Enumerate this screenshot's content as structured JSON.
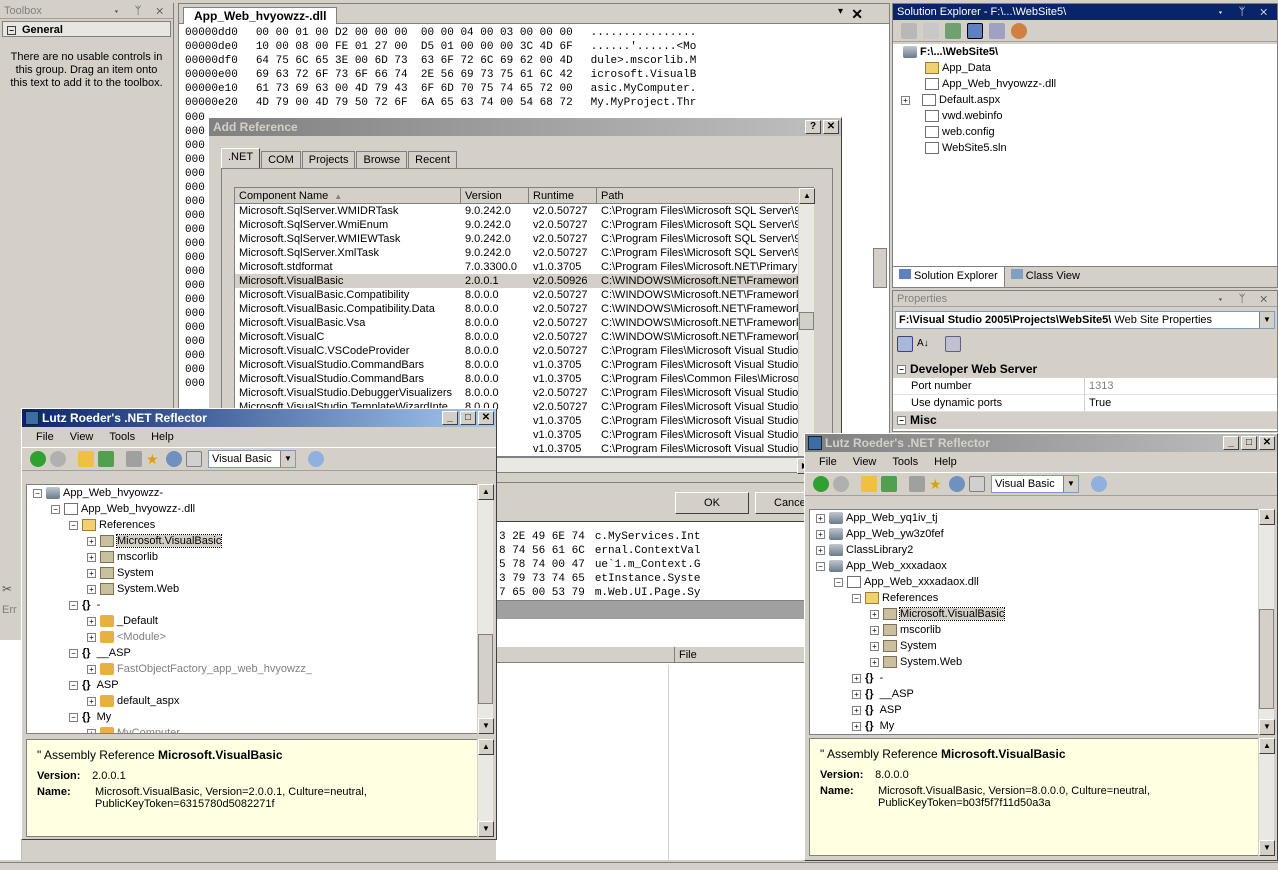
{
  "toolbox": {
    "title": "Toolbox",
    "ctl": "▾ ᛘ ✕",
    "section": "General",
    "empty_text": "There are no usable controls in this group. Drag an item onto this text to add it to the toolbox."
  },
  "hex_editor": {
    "tab": "App_Web_hvyowzz-.dll",
    "lines_top": [
      {
        "addr": "00000dd0",
        "bytes": "00 00 01 00 D2 00 00 00  00 00 04 00 03 00 00 00",
        "ascii": "................"
      },
      {
        "addr": "00000de0",
        "bytes": "10 00 08 00 FE 01 27 00  D5 01 00 00 00 3C 4D 6F",
        "ascii": "......'......<Mo"
      },
      {
        "addr": "00000df0",
        "bytes": "64 75 6C 65 3E 00 6D 73  63 6F 72 6C 69 62 00 4D",
        "ascii": "dule>.mscorlib.M"
      },
      {
        "addr": "00000e00",
        "bytes": "69 63 72 6F 73 6F 66 74  2E 56 69 73 75 61 6C 42",
        "ascii": "icrosoft.VisualB"
      },
      {
        "addr": "00000e10",
        "bytes": "61 73 69 63 00 4D 79 43  6F 6D 70 75 74 65 72 00",
        "ascii": "asic.MyComputer."
      },
      {
        "addr": "00000e20",
        "bytes": "4D 79 00 4D 79 50 72 6F  6A 65 63 74 00 54 68 72",
        "ascii": "My.MyProject.Thr"
      }
    ],
    "lines_bottom": [
      {
        "bytes": "3 2E 49 6E 74",
        "ascii": "c.MyServices.Int"
      },
      {
        "bytes": "8 74 56 61 6C",
        "ascii": "ernal.ContextVal"
      },
      {
        "bytes": "5 78 74 00 47",
        "ascii": "ue`1.m_Context.G"
      },
      {
        "bytes": "3 79 73 74 65",
        "ascii": "etInstance.Syste"
      },
      {
        "bytes": "7 65 00 53 79",
        "ascii": "m.Web.UI.Page.Sy"
      }
    ],
    "left_stubs": [
      "000",
      "000",
      "000",
      "000",
      "000",
      "000",
      "000",
      "000",
      "000",
      "000",
      "000",
      "000",
      "000",
      "000",
      "000",
      "000",
      "000",
      "000",
      "000",
      "000"
    ]
  },
  "error_list": {
    "file_col": "File",
    "title_stub": "Err"
  },
  "add_reference": {
    "title": "Add Reference",
    "tabs": [
      ".NET",
      "COM",
      "Projects",
      "Browse",
      "Recent"
    ],
    "columns": [
      "Component Name",
      "Version",
      "Runtime",
      "Path"
    ],
    "rows": [
      [
        "Microsoft.SqlServer.WMIDRTask",
        "9.0.242.0",
        "v2.0.50727",
        "C:\\Program Files\\Microsoft SQL Server\\9"
      ],
      [
        "Microsoft.SqlServer.WmiEnum",
        "9.0.242.0",
        "v2.0.50727",
        "C:\\Program Files\\Microsoft SQL Server\\9"
      ],
      [
        "Microsoft.SqlServer.WMIEWTask",
        "9.0.242.0",
        "v2.0.50727",
        "C:\\Program Files\\Microsoft SQL Server\\9"
      ],
      [
        "Microsoft.SqlServer.XmlTask",
        "9.0.242.0",
        "v2.0.50727",
        "C:\\Program Files\\Microsoft SQL Server\\9"
      ],
      [
        "Microsoft.stdformat",
        "7.0.3300.0",
        "v1.0.3705",
        "C:\\Program Files\\Microsoft.NET\\Primary"
      ],
      [
        "Microsoft.VisualBasic",
        "2.0.0.1",
        "v2.0.50926",
        "C:\\WINDOWS\\Microsoft.NET\\Framework"
      ],
      [
        "Microsoft.VisualBasic.Compatibility",
        "8.0.0.0",
        "v2.0.50727",
        "C:\\WINDOWS\\Microsoft.NET\\Framework"
      ],
      [
        "Microsoft.VisualBasic.Compatibility.Data",
        "8.0.0.0",
        "v2.0.50727",
        "C:\\WINDOWS\\Microsoft.NET\\Framework"
      ],
      [
        "Microsoft.VisualBasic.Vsa",
        "8.0.0.0",
        "v2.0.50727",
        "C:\\WINDOWS\\Microsoft.NET\\Framework"
      ],
      [
        "Microsoft.VisualC",
        "8.0.0.0",
        "v2.0.50727",
        "C:\\WINDOWS\\Microsoft.NET\\Framework"
      ],
      [
        "Microsoft.VisualC.VSCodeProvider",
        "8.0.0.0",
        "v2.0.50727",
        "C:\\Program Files\\Microsoft Visual Studio 8"
      ],
      [
        "Microsoft.VisualStudio.CommandBars",
        "8.0.0.0",
        "v1.0.3705",
        "C:\\Program Files\\Microsoft Visual Studio 8"
      ],
      [
        "Microsoft.VisualStudio.CommandBars",
        "8.0.0.0",
        "v1.0.3705",
        "C:\\Program Files\\Common Files\\Microsoft"
      ],
      [
        "Microsoft.VisualStudio.DebuggerVisualizers",
        "8.0.0.0",
        "v2.0.50727",
        "C:\\Program Files\\Microsoft Visual Studio 8"
      ],
      [
        "Microsoft.VisualStudio.TemplateWizardInte...",
        "8.0.0.0",
        "v2.0.50727",
        "C:\\Program Files\\Microsoft Visual Studio 8"
      ]
    ],
    "extra_versions": [
      "0",
      "0",
      "0"
    ],
    "extra_runtimes": [
      "v1.0.3705",
      "v1.0.3705",
      "v1.0.3705"
    ],
    "extra_paths": [
      "C:\\Program Files\\Microsoft Visual Studio 8",
      "C:\\Program Files\\Microsoft Visual Studio 8",
      "C:\\Program Files\\Microsoft Visual Studio 8"
    ],
    "ok": "OK",
    "cancel": "Cance"
  },
  "solution_explorer": {
    "title": "Solution Explorer - F:\\...\\WebSite5\\",
    "root": "F:\\...\\WebSite5\\",
    "items": [
      "App_Data",
      "App_Web_hvyowzz-.dll",
      "Default.aspx",
      "vwd.webinfo",
      "web.config",
      "WebSite5.sln"
    ],
    "tab1": "Solution Explorer",
    "tab2": "Class View"
  },
  "properties": {
    "title": "Properties",
    "object": "F:\\Visual Studio 2005\\Projects\\WebSite5\\",
    "object_type": "Web Site Properties",
    "category1": "Developer Web Server",
    "rows": [
      {
        "name": "Port number",
        "value": "1313"
      },
      {
        "name": "Use dynamic ports",
        "value": "True"
      }
    ],
    "category2": "Misc"
  },
  "reflector_left": {
    "title": "Lutz Roeder's .NET Reflector",
    "menus": [
      "File",
      "View",
      "Tools",
      "Help"
    ],
    "language": "Visual Basic",
    "tree": [
      {
        "indent": 0,
        "exp": "−",
        "icon": "asm",
        "text": "App_Web_hvyowzz-",
        "gray": false
      },
      {
        "indent": 1,
        "exp": "−",
        "icon": "file",
        "text": "App_Web_hvyowzz-.dll",
        "gray": false
      },
      {
        "indent": 2,
        "exp": "−",
        "icon": "folder",
        "text": "References",
        "gray": false
      },
      {
        "indent": 3,
        "exp": "+",
        "icon": "ref",
        "text": "Microsoft.VisualBasic",
        "gray": false,
        "sel": true
      },
      {
        "indent": 3,
        "exp": "+",
        "icon": "ref",
        "text": "mscorlib",
        "gray": false
      },
      {
        "indent": 3,
        "exp": "+",
        "icon": "ref",
        "text": "System",
        "gray": false
      },
      {
        "indent": 3,
        "exp": "+",
        "icon": "ref",
        "text": "System.Web",
        "gray": false
      },
      {
        "indent": 2,
        "exp": "−",
        "icon": "ns",
        "text": "-",
        "gray": false
      },
      {
        "indent": 3,
        "exp": "+",
        "icon": "cls",
        "text": "_Default",
        "gray": false
      },
      {
        "indent": 3,
        "exp": "+",
        "icon": "cls",
        "text": "<Module>",
        "gray": true
      },
      {
        "indent": 2,
        "exp": "−",
        "icon": "ns",
        "text": "__ASP",
        "gray": false
      },
      {
        "indent": 3,
        "exp": "+",
        "icon": "cls",
        "text": "FastObjectFactory_app_web_hvyowzz_",
        "gray": true
      },
      {
        "indent": 2,
        "exp": "−",
        "icon": "ns",
        "text": "ASP",
        "gray": false
      },
      {
        "indent": 3,
        "exp": "+",
        "icon": "cls",
        "text": "default_aspx",
        "gray": false
      },
      {
        "indent": 2,
        "exp": "−",
        "icon": "ns",
        "text": "My",
        "gray": false
      },
      {
        "indent": 3,
        "exp": "+",
        "icon": "cls",
        "text": "MyComputer",
        "gray": true
      }
    ],
    "info_heading_prefix": "Assembly Reference",
    "info_heading_name": "Microsoft.VisualBasic",
    "version_label": "Version:",
    "version": "2.0.0.1",
    "name_label": "Name:",
    "name_line1": "Microsoft.VisualBasic, Version=2.0.0.1, Culture=neutral,",
    "name_line2": "PublicKeyToken=6315780d5082271f"
  },
  "reflector_right": {
    "title": "Lutz Roeder's .NET Reflector",
    "menus": [
      "File",
      "View",
      "Tools",
      "Help"
    ],
    "language": "Visual Basic",
    "tree": [
      {
        "indent": 0,
        "exp": "+",
        "icon": "asm",
        "text": "App_Web_yq1iv_tj",
        "gray": false
      },
      {
        "indent": 0,
        "exp": "+",
        "icon": "asm",
        "text": "App_Web_yw3z0fef",
        "gray": false
      },
      {
        "indent": 0,
        "exp": "+",
        "icon": "asm",
        "text": "ClassLibrary2",
        "gray": false
      },
      {
        "indent": 0,
        "exp": "−",
        "icon": "asm",
        "text": "App_Web_xxxadaox",
        "gray": false
      },
      {
        "indent": 1,
        "exp": "−",
        "icon": "file",
        "text": "App_Web_xxxadaox.dll",
        "gray": false
      },
      {
        "indent": 2,
        "exp": "−",
        "icon": "folder",
        "text": "References",
        "gray": false
      },
      {
        "indent": 3,
        "exp": "+",
        "icon": "ref",
        "text": "Microsoft.VisualBasic",
        "gray": false,
        "sel": true
      },
      {
        "indent": 3,
        "exp": "+",
        "icon": "ref",
        "text": "mscorlib",
        "gray": false
      },
      {
        "indent": 3,
        "exp": "+",
        "icon": "ref",
        "text": "System",
        "gray": false
      },
      {
        "indent": 3,
        "exp": "+",
        "icon": "ref",
        "text": "System.Web",
        "gray": false
      },
      {
        "indent": 2,
        "exp": "+",
        "icon": "ns",
        "text": "-",
        "gray": false
      },
      {
        "indent": 2,
        "exp": "+",
        "icon": "ns",
        "text": "__ASP",
        "gray": false
      },
      {
        "indent": 2,
        "exp": "+",
        "icon": "ns",
        "text": "ASP",
        "gray": false
      },
      {
        "indent": 2,
        "exp": "+",
        "icon": "ns",
        "text": "My",
        "gray": false
      }
    ],
    "info_heading_prefix": "Assembly Reference",
    "info_heading_name": "Microsoft.VisualBasic",
    "version_label": "Version:",
    "version": "8.0.0.0",
    "name_label": "Name:",
    "name_line1": "Microsoft.VisualBasic, Version=8.0.0.0, Culture=neutral,",
    "name_line2": "PublicKeyToken=b03f5f7f11d50a3a"
  }
}
